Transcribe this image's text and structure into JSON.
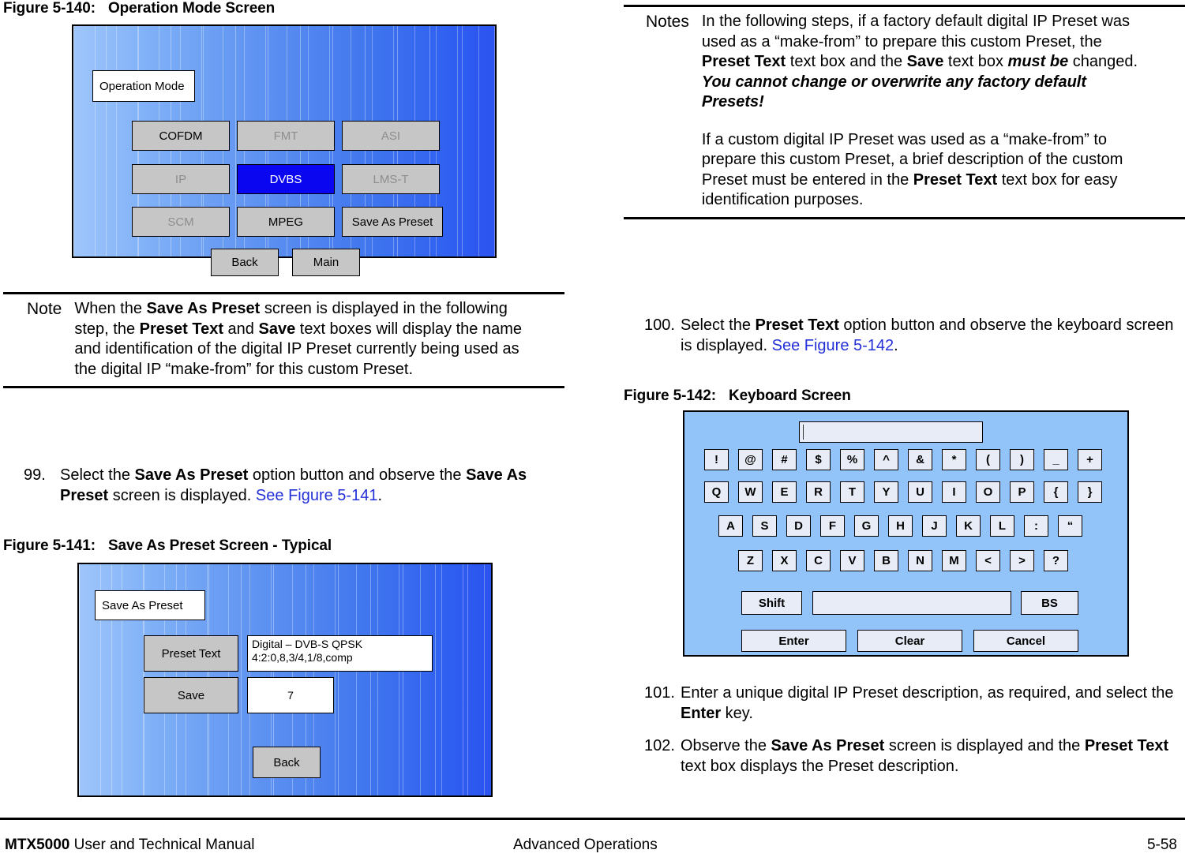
{
  "figures": {
    "fig140": {
      "number": "Figure 5-140:",
      "title": "Operation Mode Screen",
      "screen": {
        "title_box": "Operation Mode",
        "buttons": [
          {
            "label": "COFDM",
            "state": "enabled"
          },
          {
            "label": "FMT",
            "state": "disabled"
          },
          {
            "label": "ASI",
            "state": "disabled"
          },
          {
            "label": "IP",
            "state": "disabled"
          },
          {
            "label": "DVBS",
            "state": "selected"
          },
          {
            "label": "LMS-T",
            "state": "disabled"
          },
          {
            "label": "SCM",
            "state": "disabled"
          },
          {
            "label": "MPEG",
            "state": "enabled"
          },
          {
            "label": "Save As Preset",
            "state": "enabled"
          }
        ],
        "nav": [
          {
            "label": "Back"
          },
          {
            "label": "Main"
          }
        ]
      }
    },
    "fig141": {
      "number": "Figure 5-141:",
      "title": "Save As Preset Screen - Typical",
      "screen": {
        "title_box": "Save As Preset",
        "rows": [
          {
            "label": "Preset Text",
            "value_line1": "Digital – DVB-S QPSK",
            "value_line2": "4:2:0,8,3/4,1/8,comp"
          },
          {
            "label": "Save",
            "value_line1": "7",
            "value_line2": ""
          }
        ],
        "nav": [
          {
            "label": "Back"
          }
        ]
      }
    },
    "fig142": {
      "number": "Figure 5-142:",
      "title": "Keyboard Screen",
      "screen": {
        "display_value": "",
        "rows": {
          "symbols": [
            "!",
            "@",
            "#",
            "$",
            "%",
            "^",
            "&",
            "*",
            "(",
            ")",
            "_",
            "+"
          ],
          "top": [
            "Q",
            "W",
            "E",
            "R",
            "T",
            "Y",
            "U",
            "I",
            "O",
            "P",
            "{",
            "}"
          ],
          "home": [
            "A",
            "S",
            "D",
            "F",
            "G",
            "H",
            "J",
            "K",
            "L",
            ":",
            "“"
          ],
          "bottom": [
            "Z",
            "X",
            "C",
            "V",
            "B",
            "N",
            "M",
            "<",
            ">",
            "?"
          ]
        },
        "control_row": [
          {
            "label": "Shift",
            "key": "shift"
          },
          {
            "label": "",
            "key": "space"
          },
          {
            "label": "BS",
            "key": "backspace"
          }
        ],
        "action_row": [
          {
            "label": "Enter"
          },
          {
            "label": "Clear"
          },
          {
            "label": "Cancel"
          }
        ]
      }
    }
  },
  "left_note": {
    "label": "Note",
    "paragraphs": [
      {
        "runs": [
          {
            "t": "When the ",
            "s": "n"
          },
          {
            "t": "Save As Preset",
            "s": "b"
          },
          {
            "t": " screen is displayed in the following step, the ",
            "s": "n"
          },
          {
            "t": "Preset Text",
            "s": "b"
          },
          {
            "t": " and ",
            "s": "n"
          },
          {
            "t": "Save",
            "s": "b"
          },
          {
            "t": " text boxes will display the name and identification of the digital IP Preset currently being used as the digital IP “make-from” for this custom Preset.",
            "s": "n"
          }
        ]
      }
    ]
  },
  "right_notes": {
    "label": "Notes",
    "paragraphs": [
      {
        "runs": [
          {
            "t": "In the following steps, if a factory default digital IP Preset was used as a “make-from” to prepare this custom Preset, the ",
            "s": "n"
          },
          {
            "t": "Preset Text",
            "s": "b"
          },
          {
            "t": " text box and the ",
            "s": "n"
          },
          {
            "t": "Save",
            "s": "b"
          },
          {
            "t": " text box ",
            "s": "n"
          },
          {
            "t": "must be",
            "s": "bi"
          },
          {
            "t": " changed.  ",
            "s": "n"
          },
          {
            "t": "You cannot change or overwrite any factory default Presets!",
            "s": "bi"
          }
        ]
      },
      {
        "runs": [
          {
            "t": "If a custom digital IP Preset was used as a “make-from” to prepare this custom Preset, a brief description of the custom Preset must be entered in the ",
            "s": "n"
          },
          {
            "t": "Preset Text",
            "s": "b"
          },
          {
            "t": " text box for easy identification purposes.",
            "s": "n"
          }
        ]
      }
    ]
  },
  "steps": {
    "s99": {
      "number": "99.",
      "runs": [
        {
          "t": "Select the ",
          "s": "n"
        },
        {
          "t": "Save As Preset",
          "s": "b"
        },
        {
          "t": " option button and observe the ",
          "s": "n"
        },
        {
          "t": "Save As Preset",
          "s": "b"
        },
        {
          "t": " screen is displayed.  ",
          "s": "n"
        },
        {
          "t": "See Figure 5-141",
          "s": "x"
        },
        {
          "t": ".",
          "s": "n"
        }
      ]
    },
    "s100": {
      "number": "100.",
      "runs": [
        {
          "t": "Select the ",
          "s": "n"
        },
        {
          "t": "Preset Text",
          "s": "b"
        },
        {
          "t": " option button and observe the keyboard screen is displayed.  ",
          "s": "n"
        },
        {
          "t": "See Figure 5-142",
          "s": "x"
        },
        {
          "t": ".",
          "s": "n"
        }
      ]
    },
    "s101": {
      "number": "101.",
      "runs": [
        {
          "t": "Enter a unique digital IP Preset description, as required, and select the ",
          "s": "n"
        },
        {
          "t": "Enter",
          "s": "b"
        },
        {
          "t": " key.",
          "s": "n"
        }
      ]
    },
    "s102": {
      "number": "102.",
      "runs": [
        {
          "t": "Observe the ",
          "s": "n"
        },
        {
          "t": "Save As Preset",
          "s": "b"
        },
        {
          "t": " screen is displayed and the ",
          "s": "n"
        },
        {
          "t": "Preset Text",
          "s": "b"
        },
        {
          "t": " text box displays the Preset description.",
          "s": "n"
        }
      ]
    }
  },
  "footer": {
    "product": "MTX5000",
    "manual": " User and Technical Manual",
    "section": "Advanced Operations",
    "page": "5-58"
  },
  "colors": {
    "accent_blue": "#2330d8",
    "selected_key": "#0a06ef",
    "button_gray": "#c6c6c6",
    "disabled_text": "#8e8e8e",
    "keyboard_bg": "#92c3f9",
    "key_face": "#e7ecf6"
  }
}
